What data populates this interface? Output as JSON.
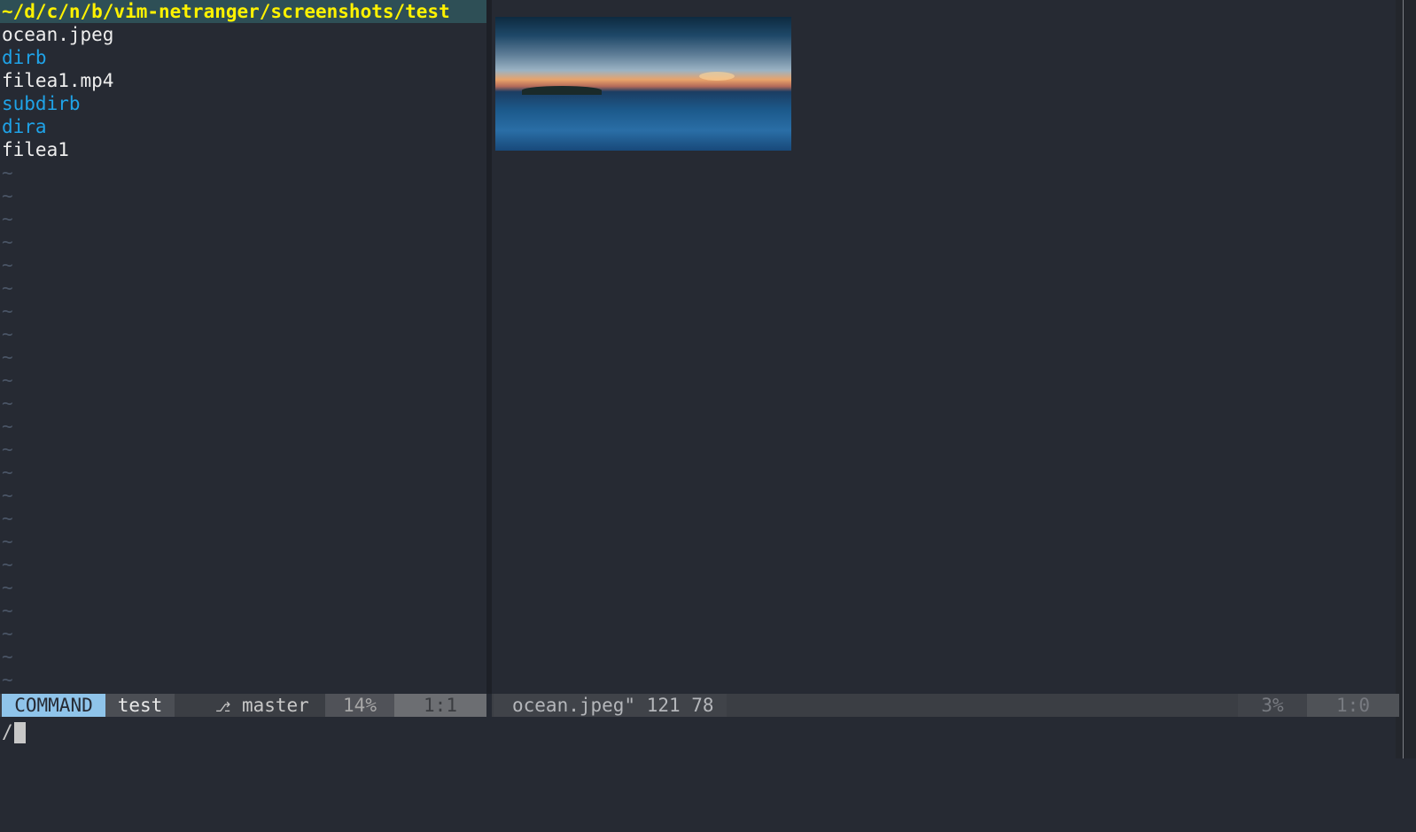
{
  "left_pane": {
    "path_header": "~/d/c/n/b/vim-netranger/screenshots/test",
    "entries": [
      {
        "name": "ocean.jpeg",
        "kind": "file"
      },
      {
        "name": "dirb",
        "kind": "dir"
      },
      {
        "name": "filea1.mp4",
        "kind": "file"
      },
      {
        "name": "subdirb",
        "kind": "dir"
      },
      {
        "name": "dira",
        "kind": "dir"
      },
      {
        "name": "filea1",
        "kind": "file"
      }
    ],
    "empty_line_marker": "~",
    "empty_line_count": 23
  },
  "left_status": {
    "mode": "COMMAND",
    "buffer": "test",
    "branch_icon": "git-branch-icon",
    "branch": "master",
    "percent": "14%",
    "position": "1:1"
  },
  "right_status": {
    "file_info": "ocean.jpeg\" 121 78",
    "percent": "3%",
    "position": "1:0"
  },
  "command_line": {
    "text": "/"
  },
  "colors": {
    "background": "#262a33",
    "path_header_bg": "#2e4f56",
    "path_header_fg": "#fff200",
    "directory": "#1fa3e8",
    "file": "#eeeeee",
    "mode_bg": "#8fc4ea"
  }
}
